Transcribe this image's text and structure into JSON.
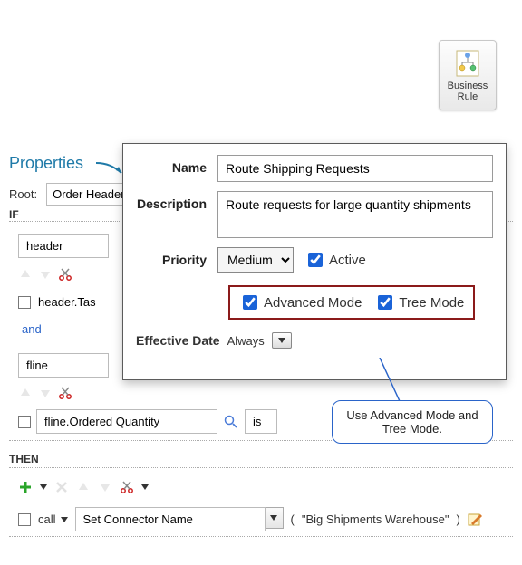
{
  "tile": {
    "label_line1": "Business",
    "label_line2": "Rule"
  },
  "properties": {
    "title": "Properties",
    "root_label": "Root:",
    "root_value": "Order Header"
  },
  "if": {
    "label": "IF",
    "header_value": "header",
    "header_task_value": "header.Tas",
    "and": "and",
    "fline_value": "fline",
    "fline_field": "fline.Ordered Quantity",
    "op": "is"
  },
  "then": {
    "label": "THEN",
    "call_label": "call",
    "action_value": "Set Connector Name",
    "quoted_arg": "\"Big Shipments Warehouse\""
  },
  "panel": {
    "name_label": "Name",
    "name_value": "Route Shipping Requests",
    "desc_label": "Description",
    "desc_value": "Route requests for large quantity shipments",
    "priority_label": "Priority",
    "priority_value": "Medium",
    "active_label": "Active",
    "advanced_label": "Advanced Mode",
    "tree_label": "Tree Mode",
    "effective_label": "Effective Date",
    "effective_value": "Always"
  },
  "callout": {
    "text": "Use Advanced Mode and Tree Mode."
  }
}
